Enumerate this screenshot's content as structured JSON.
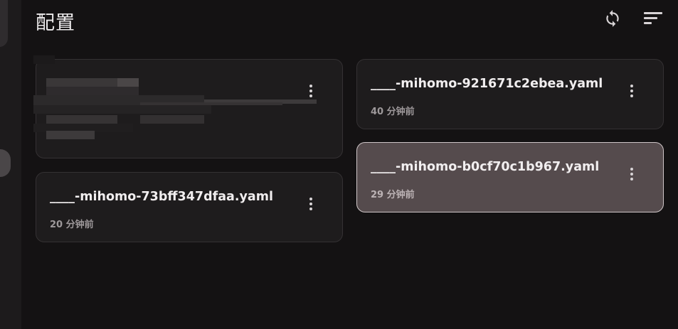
{
  "header": {
    "title": "配置",
    "refresh_icon": "refresh-icon",
    "sort_icon": "sort-icon"
  },
  "cards": [
    {
      "name": "",
      "time": "",
      "selected": false,
      "redacted": true
    },
    {
      "name": "____-mihomo-921671c2ebea.yaml",
      "time": "40 分钟前",
      "selected": false
    },
    {
      "name": "____-mihomo-b0cf70c1b967.yaml",
      "time": "29 分钟前",
      "selected": true
    },
    {
      "name": "____-mihomo-73bff347dfaa.yaml",
      "time": "20 分钟前",
      "selected": false
    }
  ],
  "colors": {
    "background": "#141213",
    "card": "#1e1c1d",
    "card_selected": "#554b4d",
    "card_selected_border": "#cfc6c8"
  }
}
